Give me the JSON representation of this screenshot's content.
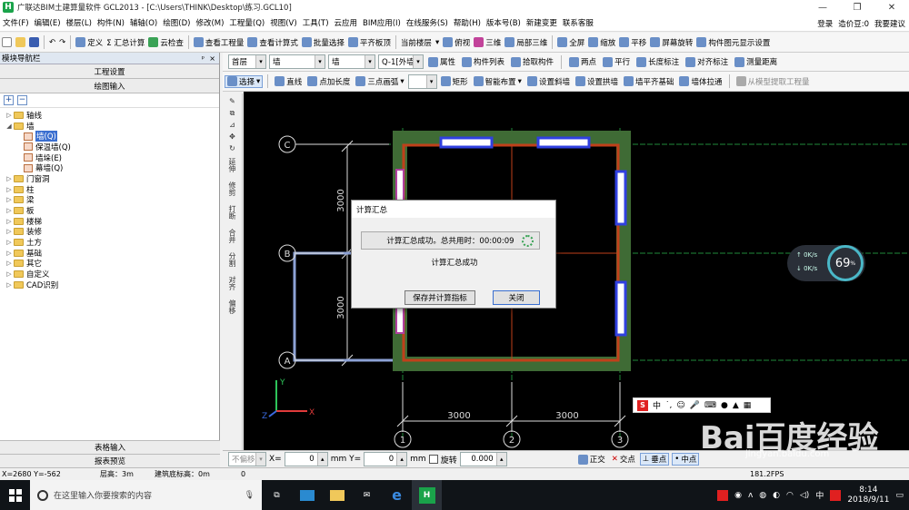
{
  "title": "广联达BIM土建算量软件 GCL2013 - [C:\\Users\\THINK\\Desktop\\练习.GCL10]",
  "menu": [
    "文件(F)",
    "编辑(E)",
    "楼层(L)",
    "构件(N)",
    "辅轴(O)",
    "绘图(D)",
    "修改(M)",
    "工程量(Q)",
    "视图(V)",
    "工具(T)",
    "云应用",
    "BIM应用(I)",
    "在线服务(S)",
    "帮助(H)",
    "版本号(B)",
    "新建变更",
    "联系客服"
  ],
  "menu_right": {
    "login": "登录",
    "price_beans": "造价豆:0",
    "feedback": "我要建议"
  },
  "toolbar1": [
    "定义",
    "Σ 汇总计算",
    "云检查",
    "查看工程量",
    "查看计算式",
    "批量选择",
    "平齐板顶",
    "当前楼层",
    "俯视",
    "三维",
    "局部三维",
    "全屏",
    "缩放",
    "平移",
    "屏幕旋转",
    "构件图元显示设置"
  ],
  "toolbar2": {
    "floor": "首层",
    "type": "墙",
    "sub": "墙",
    "name": "Q-1[外墙",
    "btns": [
      "属性",
      "构件列表",
      "拾取构件",
      "两点",
      "平行",
      "长度标注",
      "对齐标注",
      "测量距离"
    ]
  },
  "toolbar3": [
    "选择",
    "直线",
    "点加长度",
    "三点画弧",
    "矩形",
    "智能布置",
    "设置斜墙",
    "设置拱墙",
    "墙平齐基础",
    "墙体拉通",
    "从模型提取工程量"
  ],
  "left_panel": {
    "header": "模块导航栏",
    "pin": "ᵖ",
    "close": "×",
    "sections": [
      "工程设置",
      "绘图输入"
    ],
    "tree": [
      {
        "label": "轴线",
        "level": 0,
        "exp": "▷"
      },
      {
        "label": "墙",
        "level": 0,
        "exp": "◢"
      },
      {
        "label": "墙(Q)",
        "level": 1,
        "selected": true
      },
      {
        "label": "保温墙(Q)",
        "level": 1
      },
      {
        "label": "墙垛(E)",
        "level": 1
      },
      {
        "label": "幕墙(Q)",
        "level": 1
      },
      {
        "label": "门窗洞",
        "level": 0,
        "exp": "▷"
      },
      {
        "label": "柱",
        "level": 0,
        "exp": "▷"
      },
      {
        "label": "梁",
        "level": 0,
        "exp": "▷"
      },
      {
        "label": "板",
        "level": 0,
        "exp": "▷"
      },
      {
        "label": "楼梯",
        "level": 0,
        "exp": "▷"
      },
      {
        "label": "装修",
        "level": 0,
        "exp": "▷"
      },
      {
        "label": "土方",
        "level": 0,
        "exp": "▷"
      },
      {
        "label": "基础",
        "level": 0,
        "exp": "▷"
      },
      {
        "label": "其它",
        "level": 0,
        "exp": "▷"
      },
      {
        "label": "自定义",
        "level": 0,
        "exp": "▷"
      },
      {
        "label": "CAD识别",
        "level": 0,
        "exp": "▷"
      }
    ],
    "bottom": [
      "表格输入",
      "报表预览"
    ]
  },
  "vtoolbar": [
    "延伸",
    "修剪",
    "打断",
    "合并",
    "分割",
    "对齐",
    "偏移"
  ],
  "canvas": {
    "axis_labels": {
      "C": "C",
      "B": "B",
      "A": "A",
      "n1": "1",
      "n2": "2",
      "n3": "3"
    },
    "dims": {
      "d1": "3000",
      "d2": "3000",
      "v1": "3000",
      "v2": "3000"
    },
    "coords": {
      "y": "Y",
      "x": "X",
      "z": "Z"
    }
  },
  "dialog": {
    "title": "计算汇总",
    "progress": "计算汇总成功。总共用时：00:00:09",
    "message": "计算汇总成功",
    "save_btn": "保存并计算指标",
    "close_btn": "关闭"
  },
  "statusbar1": {
    "offset": "不偏移",
    "x_label": "X=",
    "x_val": "0",
    "y_label": "mm Y=",
    "y_val": "0",
    "unit": "mm",
    "rotate": "旋转",
    "rot_val": "0.000",
    "snaps": [
      "正交",
      "交点",
      "垂点",
      "中点"
    ]
  },
  "statusbar2": {
    "coords": "X=2680 Y=-562",
    "floor_h": "层高：3m",
    "base_h": "建筑底标高：0m",
    "num": "0",
    "fps": "181.2FPS"
  },
  "taskbar": {
    "search": "在这里输入你要搜索的内容",
    "time": "8:14",
    "date": "2018/9/11",
    "lang": "中"
  },
  "net": {
    "pct": "69",
    "unit": "%",
    "up": "0K/s",
    "down": "0K/s"
  },
  "ime": {
    "lang": "中"
  },
  "watermark": {
    "main": "Bai百度经验",
    "sub": "jingyan.baidu.com"
  },
  "colors": {
    "wall_green": "#3f6b35",
    "wall_red": "#c0401a",
    "window_blue": "#3040e0",
    "grid_green": "#1f8a3a",
    "axis_white": "#dddddd"
  }
}
